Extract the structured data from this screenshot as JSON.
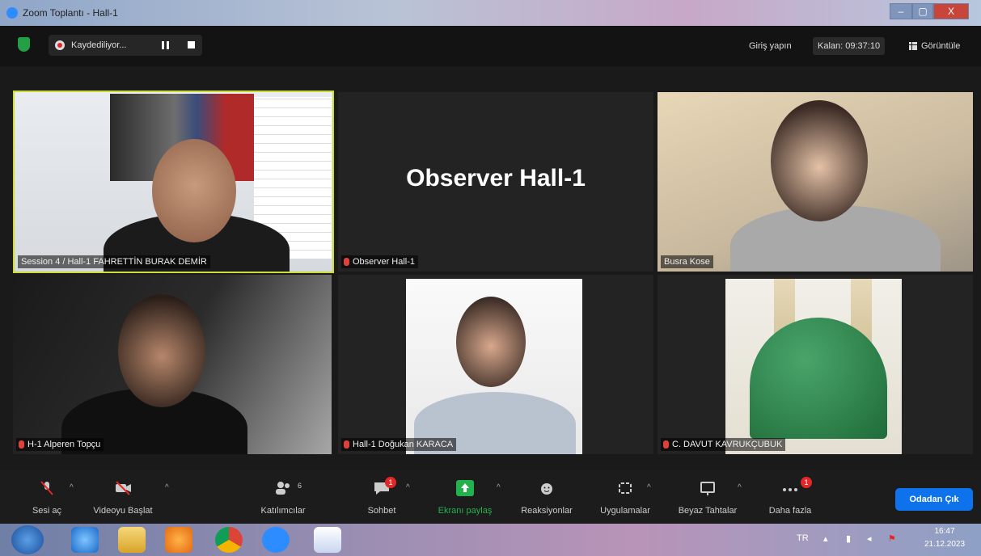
{
  "window": {
    "title": "Zoom Toplantı - Hall-1",
    "close_glyph": "X"
  },
  "topbar": {
    "recording_label": "Kaydediliyor...",
    "login_label": "Giriş yapın",
    "remaining_label": "Kalan: 09:37:10",
    "view_label": "Görüntüle"
  },
  "participants": [
    {
      "name": "Session 4 / Hall-1 FAHRETTİN BURAK DEMİR",
      "muted": false,
      "active_speaker": true
    },
    {
      "name": "Observer Hall-1",
      "muted": true,
      "display_title": "Observer Hall-1"
    },
    {
      "name": "Busra Kose",
      "muted": false
    },
    {
      "name": "H-1 Alperen Topçu",
      "muted": true
    },
    {
      "name": "Hall-1 Doğukan KARACA",
      "muted": true
    },
    {
      "name": "C. DAVUT KAVRUKÇUBUK",
      "muted": true
    }
  ],
  "toolbar": {
    "audio": "Sesi aç",
    "video": "Videoyu Başlat",
    "participants": "Katılımcılar",
    "participants_count": "6",
    "chat": "Sohbet",
    "chat_badge": "1",
    "share": "Ekranı paylaş",
    "reactions": "Reaksiyonlar",
    "apps": "Uygulamalar",
    "whiteboard": "Beyaz Tahtalar",
    "more": "Daha fazla",
    "more_badge": "1",
    "leave": "Odadan Çık"
  },
  "taskbar": {
    "language": "TR",
    "time": "16:47",
    "date": "21.12.2023"
  }
}
